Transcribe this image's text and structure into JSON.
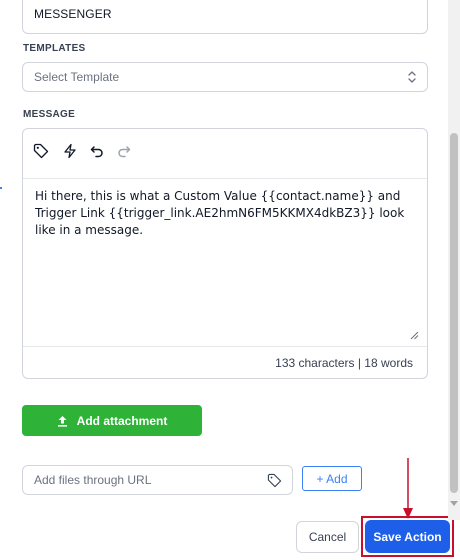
{
  "channel": {
    "value": "MESSENGER"
  },
  "templates": {
    "label": "TEMPLATES",
    "placeholder": "Select Template"
  },
  "message": {
    "label": "MESSAGE",
    "body": "Hi there, this is what a Custom Value {{contact.name}} and Trigger Link {{trigger_link.AE2hmN6FM5KKMX4dkBZ3}} look like in a message.",
    "stats": "133 characters | 18 words",
    "toolbar_icons": [
      "tag-icon",
      "lightning-icon",
      "undo-icon",
      "redo-icon"
    ]
  },
  "attachment": {
    "button_label": "Add attachment"
  },
  "url_upload": {
    "placeholder": "Add files through URL",
    "add_label": "+ Add"
  },
  "footer": {
    "cancel_label": "Cancel",
    "save_label": "Save Action"
  },
  "colors": {
    "green_button": "#2fb238",
    "primary_button": "#1d5fe8",
    "link_blue": "#3b82f6",
    "highlight_red": "#c8102e"
  }
}
